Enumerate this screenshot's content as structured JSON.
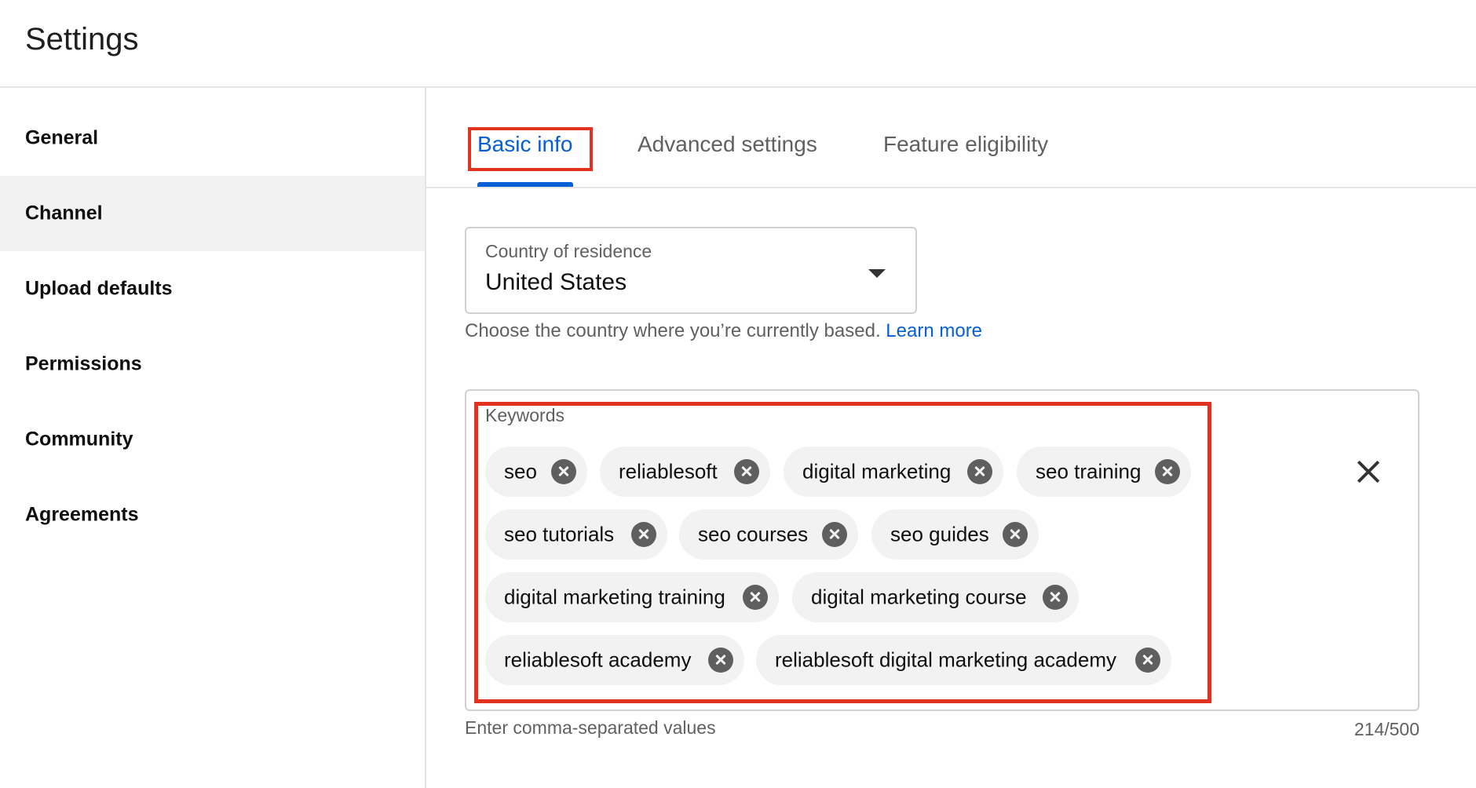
{
  "page": {
    "title": "Settings"
  },
  "sidebar": {
    "items": [
      {
        "label": "General",
        "active": false
      },
      {
        "label": "Channel",
        "active": true
      },
      {
        "label": "Upload defaults",
        "active": false
      },
      {
        "label": "Permissions",
        "active": false
      },
      {
        "label": "Community",
        "active": false
      },
      {
        "label": "Agreements",
        "active": false
      }
    ]
  },
  "tabs": [
    {
      "label": "Basic info",
      "active": true
    },
    {
      "label": "Advanced settings",
      "active": false
    },
    {
      "label": "Feature eligibility",
      "active": false
    }
  ],
  "country": {
    "label": "Country of residence",
    "value": "United States",
    "helper": "Choose the country where you’re currently based.",
    "learn_more": "Learn more"
  },
  "keywords": {
    "label": "Keywords",
    "chips": [
      "seo",
      "reliablesoft",
      "digital marketing",
      "seo training",
      "seo tutorials",
      "seo courses",
      "seo guides",
      "digital marketing training",
      "digital marketing course",
      "reliablesoft academy",
      "reliablesoft digital marketing academy"
    ],
    "hint": "Enter comma-separated values",
    "count": "214/500"
  },
  "colors": {
    "accent": "#065fd4",
    "highlight": "#e0321e",
    "chip_bg": "#f2f2f2"
  },
  "icons": [
    "caret-down-icon",
    "chip-remove-icon",
    "clear-icon"
  ]
}
